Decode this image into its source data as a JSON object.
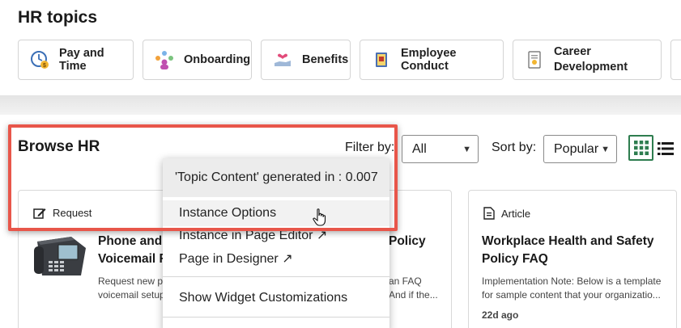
{
  "hr_topics": {
    "title": "HR topics",
    "items": [
      {
        "label": "Pay and Time",
        "icon": "clock-money-icon"
      },
      {
        "label": "Onboarding",
        "icon": "people-network-icon"
      },
      {
        "label": "Benefits",
        "icon": "hand-heart-icon"
      },
      {
        "label": "Employee Conduct",
        "icon": "book-icon"
      },
      {
        "label_line1": "Career",
        "label_line2": "Development",
        "icon": "document-award-icon"
      }
    ]
  },
  "browse": {
    "title": "Browse HR",
    "filter_label": "Filter by:",
    "filter_value": "All",
    "sort_label": "Sort by:",
    "sort_value": "Popular"
  },
  "cards": [
    {
      "type": "Request",
      "title_line1": "Phone and",
      "title_line2": "Voicemail R",
      "desc_line1": "Request new pl",
      "desc_line2": "voicemail setup"
    },
    {
      "title_fragment": "Policy",
      "desc_line1": "an FAQ",
      "desc_line2": "And if the..."
    },
    {
      "type": "Article",
      "title_line1": "Workplace Health and Safety",
      "title_line2": "Policy FAQ",
      "desc_line1": "Implementation Note: Below is a template",
      "desc_line2": "for sample content that your organizatio...",
      "date": "22d ago"
    }
  ],
  "context_menu": {
    "generated": "'Topic Content' generated in : 0.007",
    "items": [
      "Instance Options",
      "Instance in Page Editor ↗",
      "Page in Designer ↗",
      "Show Widget Customizations"
    ]
  },
  "colors": {
    "highlight": "#e8564a",
    "grid_toggle": "#2e7d4f"
  }
}
